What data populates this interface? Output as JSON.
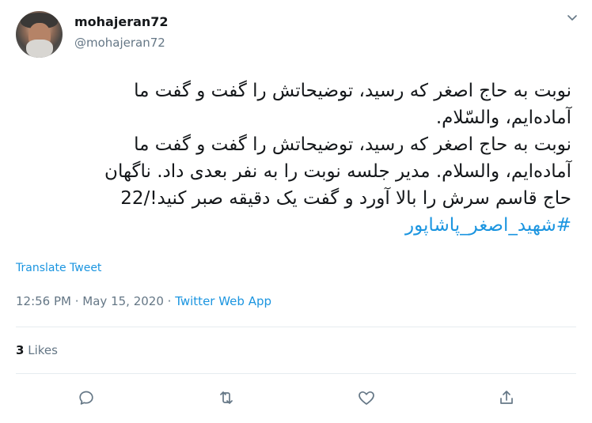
{
  "author": {
    "name": "mohajeran72",
    "handle": "@mohajeran72"
  },
  "tweet": {
    "lines": [
      "نوبت به حاج اصغر که رسید، توضیحاتش را گفت و گفت ما",
      "آماده‌ایم، والسّلام.",
      "نوبت به حاج اصغر که رسید، توضیحاتش را گفت و گفت ما",
      "آماده‌ایم، والسلام. مدیر جلسه نوبت را به نفر بعدی داد. ناگهان",
      "حاج قاسم سرش را بالا آورد و گفت یک دقیقه صبر کنید!/22"
    ],
    "hashtag": "#شهید_اصغر_پاشاپور"
  },
  "translate_label": "Translate Tweet",
  "meta": {
    "time": "12:56 PM",
    "separator1": " · ",
    "date": "May 15, 2020",
    "separator2": " · ",
    "source": "Twitter Web App"
  },
  "likes": {
    "count": "3",
    "label": " Likes"
  },
  "icons": {
    "reply": "reply-icon",
    "retweet": "retweet-icon",
    "like": "like-icon",
    "share": "share-icon",
    "caret": "chevron-down-icon"
  },
  "colors": {
    "accent": "#1b95e0",
    "muted": "#657786",
    "text": "#14171a",
    "divider": "#e6ecf0"
  }
}
